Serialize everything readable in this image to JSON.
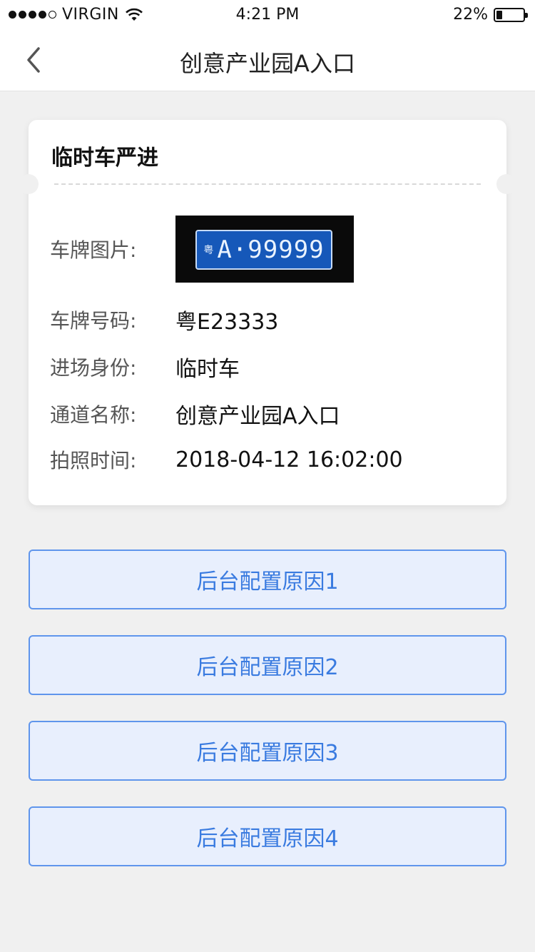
{
  "status_bar": {
    "carrier": "VIRGIN",
    "time": "4:21 PM",
    "battery_percent": "22%",
    "battery_level": 0.22,
    "signal_bars_filled": 4,
    "signal_bars_total": 5
  },
  "nav": {
    "title": "创意产业园A入口",
    "back_icon": "chevron-left-icon"
  },
  "card": {
    "title": "临时车严进",
    "plate_image_label": "车牌图片:",
    "plate_image_province": "粤",
    "plate_image_text": "A·99999",
    "fields": [
      {
        "label": "车牌号码:",
        "value": "粤E23333"
      },
      {
        "label": "进场身份:",
        "value": "临时车"
      },
      {
        "label": "通道名称:",
        "value": "创意产业园A入口"
      },
      {
        "label": "拍照时间:",
        "value": "2018-04-12 16:02:00"
      }
    ]
  },
  "reasons": [
    {
      "label": "后台配置原因1"
    },
    {
      "label": "后台配置原因2"
    },
    {
      "label": "后台配置原因3"
    },
    {
      "label": "后台配置原因4"
    }
  ],
  "colors": {
    "accent": "#3a7be0",
    "button_bg": "#e8effd",
    "button_border": "#5f95ec",
    "page_bg": "#f0f0f0"
  }
}
